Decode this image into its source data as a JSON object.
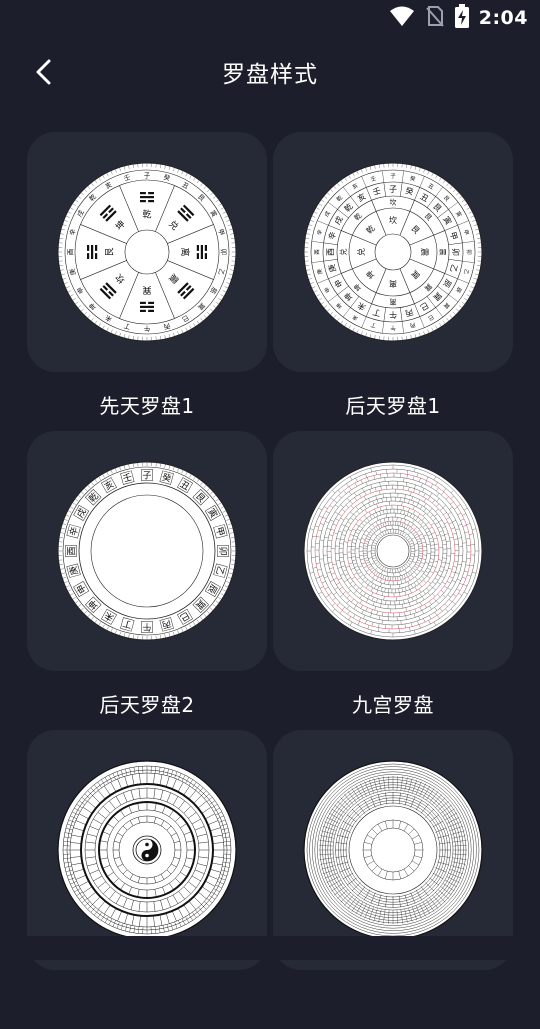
{
  "status": {
    "time": "2:04"
  },
  "header": {
    "title": "罗盘样式"
  },
  "compasses": [
    {
      "label": "先天罗盘1"
    },
    {
      "label": "后天罗盘1"
    },
    {
      "label": "后天罗盘2"
    },
    {
      "label": "九宫罗盘"
    },
    {
      "label": ""
    },
    {
      "label": ""
    }
  ],
  "compass_text": {
    "ring_24": [
      "子",
      "癸",
      "丑",
      "艮",
      "寅",
      "甲",
      "卯",
      "乙",
      "辰",
      "巽",
      "巳",
      "丙",
      "午",
      "丁",
      "未",
      "坤",
      "申",
      "庚",
      "酉",
      "辛",
      "戌",
      "乾",
      "亥",
      "壬"
    ],
    "trigrams_xiantian": [
      "乾",
      "兑",
      "离",
      "震",
      "巽",
      "坎",
      "艮",
      "坤"
    ],
    "trigrams_houtian": [
      "坎",
      "艮",
      "震",
      "巽",
      "离",
      "坤",
      "兑",
      "乾"
    ]
  }
}
